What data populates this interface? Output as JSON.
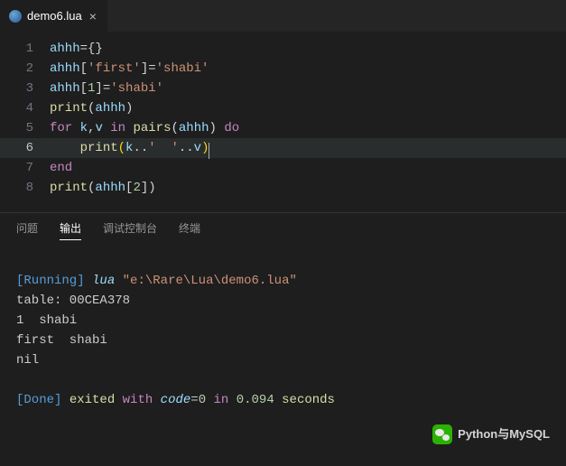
{
  "tab": {
    "filename": "demo6.lua",
    "icon": "lua-icon",
    "close": "×"
  },
  "editor": {
    "lines": [
      "1",
      "2",
      "3",
      "4",
      "5",
      "6",
      "7",
      "8"
    ],
    "l1": {
      "v1": "ahhh",
      "op": "=",
      "brace": "{}"
    },
    "l2": {
      "v1": "ahhh",
      "lb": "[",
      "s1": "'first'",
      "rb": "]",
      "op": "=",
      "s2": "'shabi'"
    },
    "l3": {
      "v1": "ahhh",
      "lb": "[",
      "n1": "1",
      "rb": "]",
      "op": "=",
      "s2": "'shabi'"
    },
    "l4": {
      "fn": "print",
      "lp": "(",
      "v1": "ahhh",
      "rp": ")"
    },
    "l5": {
      "kw1": "for",
      "v1": "k",
      "c": ",",
      "v2": "v",
      "kw2": "in",
      "fn": "pairs",
      "lp": "(",
      "v3": "ahhh",
      "rp": ")",
      "kw3": "do"
    },
    "l6": {
      "fn": "print",
      "lpb": "(",
      "v1": "k",
      "op1": "..",
      "s1": "'  '",
      "op2": "..",
      "v2": "v",
      "rpb": ")"
    },
    "l7": {
      "kw": "end"
    },
    "l8": {
      "fn": "print",
      "lp": "(",
      "v1": "ahhh",
      "lb": "[",
      "n1": "2",
      "rb": "]",
      "rp": ")"
    }
  },
  "panel": {
    "tabs": {
      "problems": "问题",
      "output": "输出",
      "debug": "调试控制台",
      "terminal": "终端"
    }
  },
  "output": {
    "run_tag": "[Running]",
    "cmd": "lua",
    "path": "\"e:\\Rare\\Lua\\demo6.lua\"",
    "line1": "table: 00CEA378",
    "line2": "1  shabi",
    "line3": "first  shabi",
    "line4": "nil",
    "done_tag": "[Done]",
    "exited": "exited",
    "with": "with",
    "code_lbl": "code",
    "eq": "=",
    "code_val": "0",
    "in": "in",
    "time": "0.094",
    "seconds": "seconds"
  },
  "watermark": {
    "text": "Python与MySQL"
  }
}
